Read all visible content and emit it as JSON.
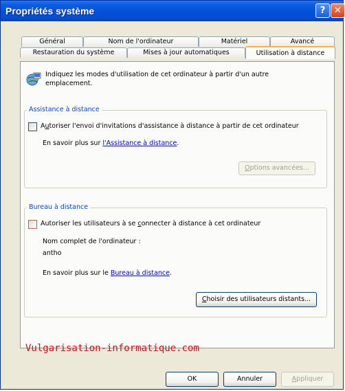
{
  "window": {
    "title": "Propriétés système",
    "help_button": "?",
    "close_button": "✕"
  },
  "tabs": {
    "row_back": [
      {
        "label": "Général"
      },
      {
        "label": "Nom de l'ordinateur"
      },
      {
        "label": "Matériel"
      },
      {
        "label": "Avancé"
      }
    ],
    "row_front": [
      {
        "label": "Restauration du système"
      },
      {
        "label": "Mises à jour automatiques"
      },
      {
        "label": "Utilisation à distance"
      }
    ]
  },
  "intro": {
    "text": "Indiquez les modes d'utilisation de cet ordinateur à partir d'un autre emplacement.",
    "icon": "remote-computer-icon"
  },
  "assistance": {
    "legend": "Assistance à distance",
    "checkbox_pre": "A",
    "checkbox_mnemonic": "u",
    "checkbox_post": "toriser l'envoi d'invitations d'assistance à distance à partir de cet ordinateur",
    "checked": false,
    "learn_more_prefix": "En savoir plus sur ",
    "learn_more_link": "l'Assistance à distance",
    "learn_more_suffix": ".",
    "advanced_button_pre": "O",
    "advanced_button_post": "ptions avancées...",
    "advanced_button_enabled": false
  },
  "bureau": {
    "legend": "Bureau à distance",
    "checkbox_pre": "Autoriser les utilisateurs à se ",
    "checkbox_mnemonic": "c",
    "checkbox_post": "onnecter à distance à cet ordinateur",
    "checked": false,
    "computer_name_label": "Nom complet de l'ordinateur :",
    "computer_name_value": "antho",
    "learn_more_prefix": "En savoir plus sur le ",
    "learn_more_link": "Bureau à distance",
    "learn_more_suffix": ".",
    "choose_users_pre": "C",
    "choose_users_post": "hoisir des utilisateurs distants..."
  },
  "watermark": "Vulgarisation-informatique.com",
  "footer": {
    "ok": "OK",
    "cancel": "Annuler",
    "apply_pre": "A",
    "apply_post": "ppliquer",
    "apply_enabled": false
  },
  "colors": {
    "titlebar": "#0151d8",
    "dialog_bg": "#ece9d8",
    "legend": "#0046d5",
    "link": "#0000cc",
    "watermark": "#cc1212"
  }
}
